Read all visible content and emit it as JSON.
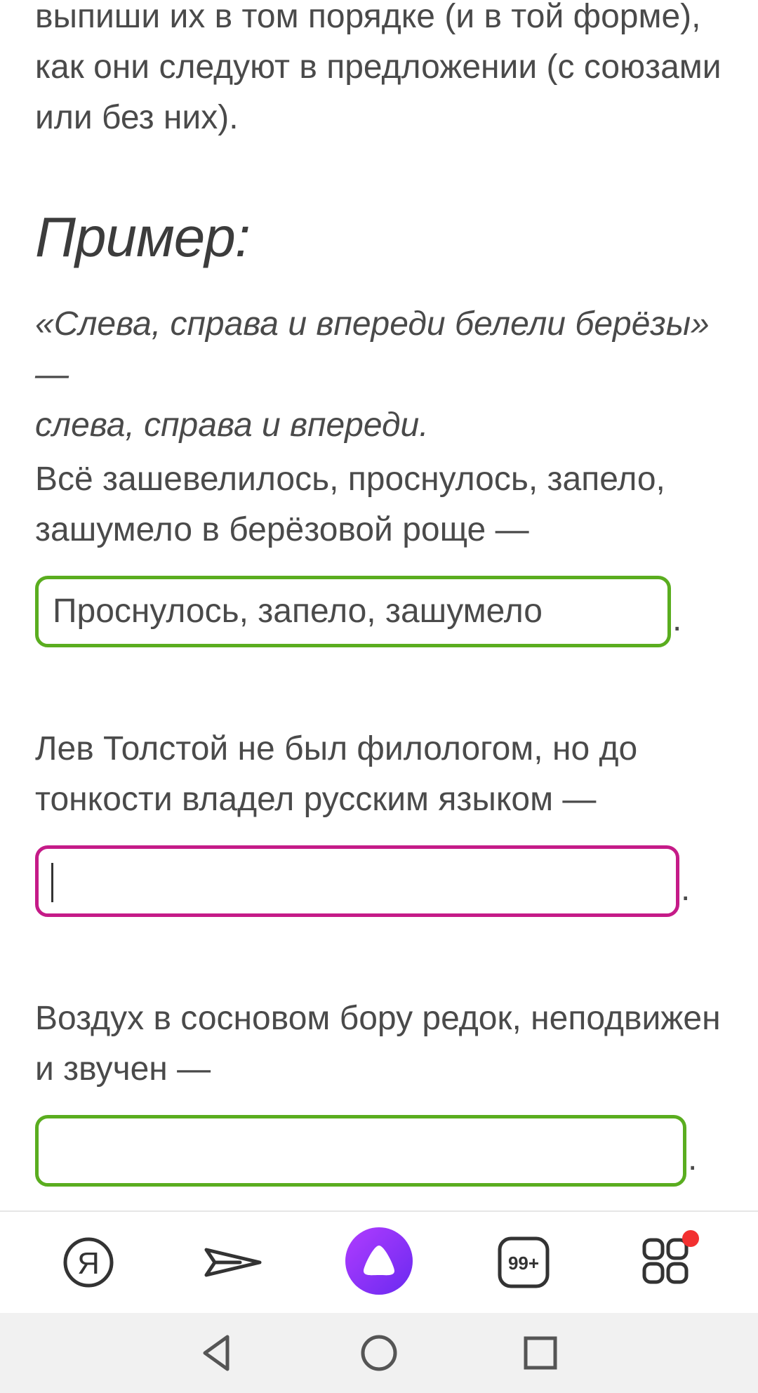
{
  "instructions": {
    "line1": "выпиши их в том порядке (и в той форме),",
    "line2": "как они следуют в предложении (с союзами",
    "line3": "или без них)."
  },
  "example": {
    "heading": "Пример:",
    "line1": "«Слева, справа и впереди белели берёзы» —",
    "line2": "слева, справа и впереди."
  },
  "tasks": [
    {
      "line1": "Всё зашевелилось, проснулось, запело,",
      "line2": "зашумело в берёзовой роще —",
      "answer": "Проснулось, запело, зашумело",
      "status_color": "#5aad1f",
      "period": "."
    },
    {
      "line1": "Лев Толстой не был филологом, но до",
      "line2": "тонкости владел русским языком —",
      "answer": "",
      "status_color": "#c51b88",
      "period": "."
    },
    {
      "line1": "Воздух в сосновом бору редок, неподвижен",
      "line2": "и звучен —",
      "answer": "",
      "status_color": "#5aad1f",
      "period": "."
    }
  ],
  "bottom_nav": {
    "yandex_label": "Я",
    "tabs_badge": "99+",
    "alice_color": "#8b2cf5",
    "notification_dot_color": "#f23030"
  },
  "system_nav": {
    "back": "back-icon",
    "home": "home-icon",
    "recents": "recents-icon"
  }
}
